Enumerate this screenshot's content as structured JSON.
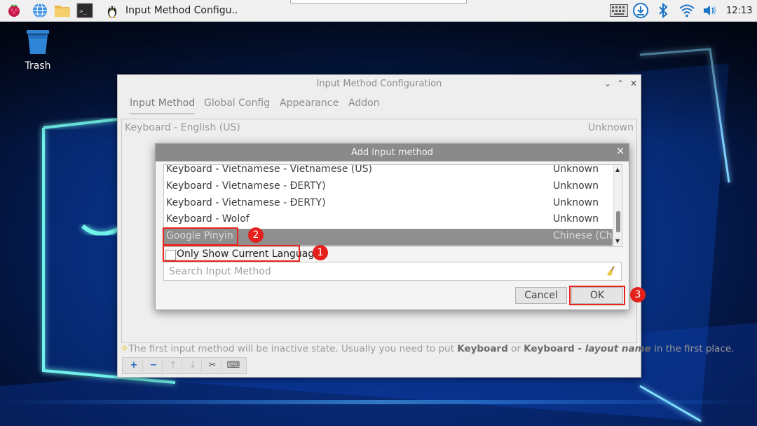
{
  "taskbar": {
    "active_window_title": "Input Method Configu..",
    "clock": "12:13",
    "icons": [
      "raspberry-menu-icon",
      "web-browser-icon",
      "file-manager-icon",
      "terminal-icon",
      "fcitx-penguin-icon"
    ],
    "tray_icons": [
      "keyboard-icon",
      "updater-icon",
      "bluetooth-icon",
      "wifi-icon",
      "volume-icon"
    ]
  },
  "desktop": {
    "trash_label": "Trash"
  },
  "main_window": {
    "title": "Input Method Configuration",
    "tabs": [
      {
        "label": "Input Method"
      },
      {
        "label": "Global Config"
      },
      {
        "label": "Appearance"
      },
      {
        "label": "Addon"
      }
    ],
    "current_item": {
      "name": "Keyboard - English (US)",
      "status": "Unknown"
    },
    "hint": {
      "prefix": "The first input method will be inactive state. Usually you need to put ",
      "bold1": "Keyboard",
      "mid": " or ",
      "bold2": "Keyboard - ",
      "bold2_italic": "layout name",
      "suffix": " in the first place."
    },
    "toolbar": [
      "add-icon",
      "remove-icon",
      "move-up-icon",
      "move-down-icon",
      "configure-icon",
      "keyboard-layout-icon"
    ]
  },
  "dialog": {
    "title": "Add input method",
    "items": [
      {
        "name": "Keyboard - Vietnamese - Vietnamese (US)",
        "status": "Unknown"
      },
      {
        "name": "Keyboard - Vietnamese - ĐERTY)",
        "status": "Unknown"
      },
      {
        "name": "Keyboard - Vietnamese - ĐERTY)",
        "status": "Unknown"
      },
      {
        "name": "Keyboard - Wolof",
        "status": "Unknown"
      },
      {
        "name": "Google Pinyin",
        "status": "Chinese (China)"
      }
    ],
    "selected_index": 4,
    "only_show_label": "Only Show Current Language",
    "search_placeholder": "Search Input Method",
    "cancel_label": "Cancel",
    "ok_label": "OK"
  },
  "annotations": {
    "badge1": "1",
    "badge2": "2",
    "badge3": "3",
    "color": "#e3201b"
  }
}
